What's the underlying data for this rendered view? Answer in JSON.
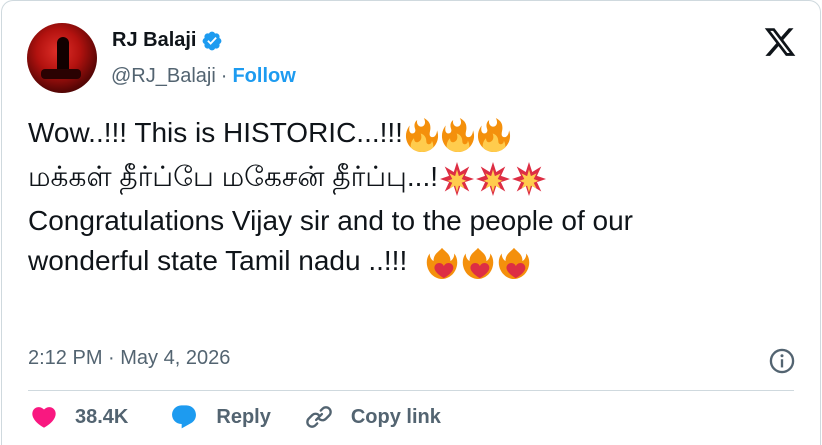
{
  "author": {
    "name": "RJ Balaji",
    "handle": "@RJ_Balaji",
    "separator": "·",
    "follow_label": "Follow",
    "verified": true
  },
  "tweet": {
    "line1": "Wow..!!!  This is HISTORIC...!!!",
    "line1_emoji": [
      "fire-emoji",
      "fire-emoji",
      "fire-emoji"
    ],
    "line2": "மக்கள் தீர்ப்பே மகேசன் தீர்ப்பு...!",
    "line2_emoji": [
      "collision-emoji",
      "collision-emoji",
      "collision-emoji"
    ],
    "line3a": "Congratulations Vijay sir and to the people of our",
    "line3b": "wonderful state Tamil nadu ..!!!  ",
    "line3_emoji": [
      "heart-on-fire-emoji",
      "heart-on-fire-emoji",
      "heart-on-fire-emoji"
    ]
  },
  "meta": {
    "timestamp": "2:12 PM · May 4, 2026"
  },
  "actions": {
    "like_count": "38.4K",
    "reply_label": "Reply",
    "copy_label": "Copy link"
  },
  "colors": {
    "accent": "#1d9bf0",
    "like": "#f91880",
    "text": "#0f1419",
    "muted": "#536471"
  },
  "icons": {
    "logo": "x-logo-icon",
    "verified": "verified-badge-icon",
    "info": "info-icon",
    "like": "heart-icon",
    "reply": "reply-icon",
    "copy": "link-icon"
  }
}
